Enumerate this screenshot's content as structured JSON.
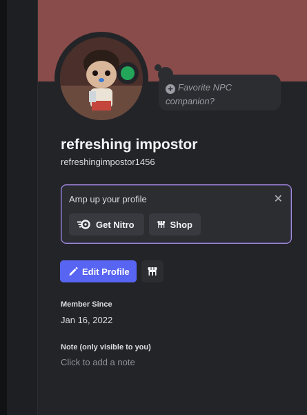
{
  "profile": {
    "custom_status_placeholder": "Favorite NPC companion?",
    "display_name": "refreshing impostor",
    "username": "refreshingimpostor1456",
    "status": "online"
  },
  "nitro_upsell": {
    "title": "Amp up your profile",
    "get_nitro_label": "Get Nitro",
    "shop_label": "Shop"
  },
  "actions": {
    "edit_profile_label": "Edit Profile"
  },
  "member_since": {
    "label": "Member Since",
    "value": "Jan 16, 2022"
  },
  "note": {
    "label": "Note (only visible to you)",
    "placeholder": "Click to add a note"
  },
  "colors": {
    "banner": "#8a4c4a",
    "accent": "#5865f2",
    "status_online": "#23a55a",
    "nitro_border": "#a78bdb"
  },
  "icons": {
    "add_status": "plus-circle-icon",
    "close": "close-icon",
    "nitro": "nitro-icon",
    "shop": "shop-icon",
    "edit": "pencil-icon"
  }
}
